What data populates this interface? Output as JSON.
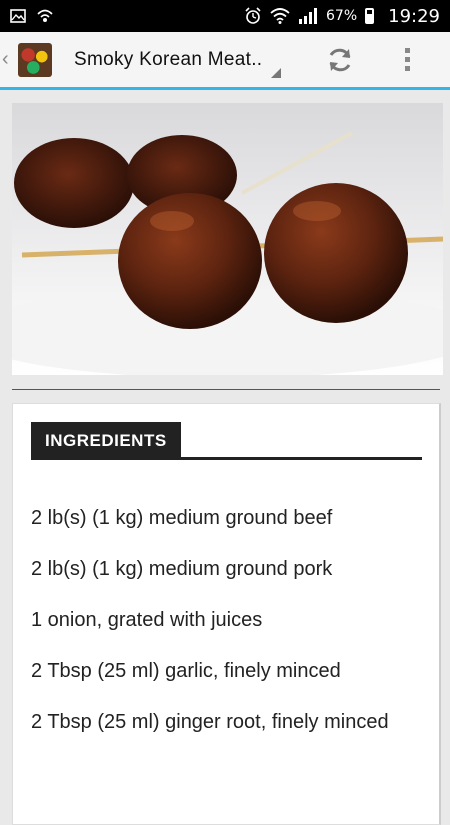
{
  "status_bar": {
    "battery_text": "67%",
    "time": "19:29",
    "icons": [
      "image-icon",
      "signal-shield-icon",
      "alarm-icon",
      "wifi-icon",
      "cell-signal-icon",
      "battery-icon"
    ]
  },
  "action_bar": {
    "title": "Smoky Korean Meat..",
    "icons": [
      "up-chevron-icon",
      "app-logo",
      "refresh-icon",
      "overflow-menu-icon"
    ],
    "accent_color": "#33b5e5"
  },
  "hero_image": {
    "subject": "glazed meatballs on skewers"
  },
  "ingredients": {
    "heading": "INGREDIENTS",
    "items": [
      "2 lb(s) (1 kg) medium ground beef",
      "2 lb(s) (1 kg) medium ground pork",
      "1 onion, grated with juices",
      "2 Tbsp (25 ml) garlic, finely minced",
      "2 Tbsp (25 ml) ginger root, finely minced"
    ]
  }
}
